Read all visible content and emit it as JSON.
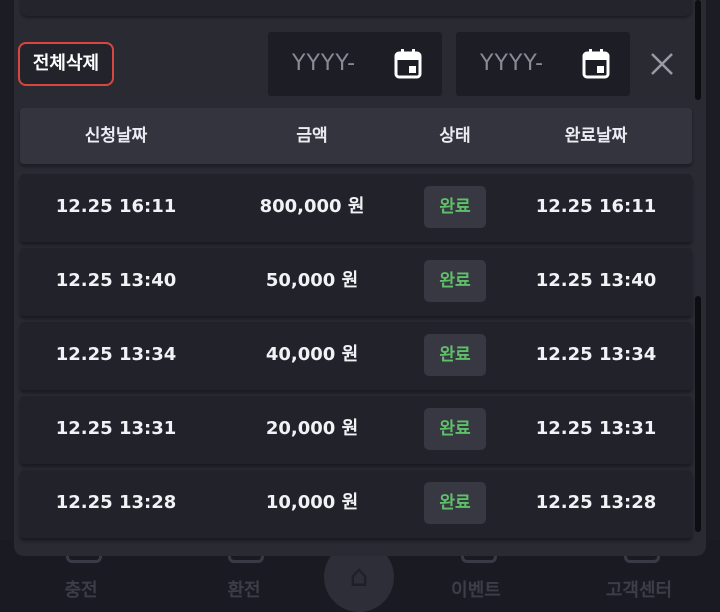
{
  "bottom_nav": {
    "items": [
      {
        "label": "충전"
      },
      {
        "label": "환전"
      },
      {
        "label": "이벤트"
      },
      {
        "label": "고객센터"
      }
    ]
  },
  "modal": {
    "delete_all_label": "전체삭제",
    "start_date_placeholder": "YYYY-",
    "end_date_placeholder": "YYYY-",
    "columns": [
      "신청날짜",
      "금액",
      "상태",
      "완료날짜"
    ],
    "rows": [
      {
        "request_date": "12.25 16:11",
        "amount": "800,000 원",
        "status": "완료",
        "done_date": "12.25 16:11"
      },
      {
        "request_date": "12.25 13:40",
        "amount": "50,000 원",
        "status": "완료",
        "done_date": "12.25 13:40"
      },
      {
        "request_date": "12.25 13:34",
        "amount": "40,000 원",
        "status": "완료",
        "done_date": "12.25 13:34"
      },
      {
        "request_date": "12.25 13:31",
        "amount": "20,000 원",
        "status": "완료",
        "done_date": "12.25 13:31"
      },
      {
        "request_date": "12.25 13:28",
        "amount": "10,000 원",
        "status": "완료",
        "done_date": "12.25 13:28"
      }
    ]
  },
  "colors": {
    "background": "#1c1c24",
    "modal_bg": "#2a2a33",
    "row_bg": "#22222a",
    "header_bg": "#34343f",
    "delete_border": "#d9463e",
    "status_green": "#5fc06a"
  },
  "icons": [
    "calendar-icon",
    "close-icon",
    "home-icon"
  ]
}
